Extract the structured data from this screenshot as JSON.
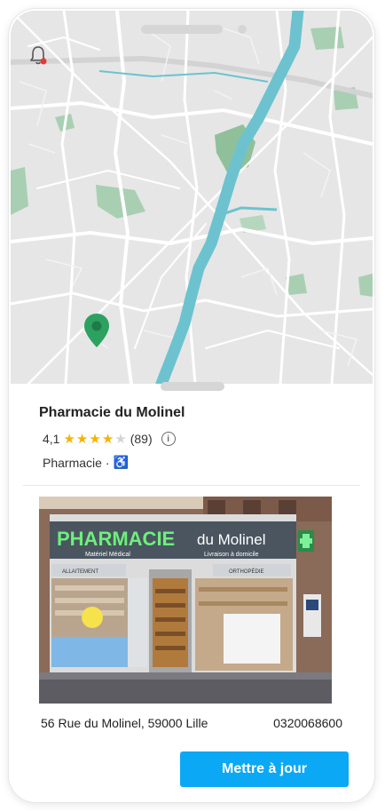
{
  "map": {
    "notification_icon": "bell-icon",
    "marker_icon": "location-pin-icon",
    "colors": {
      "background": "#e6e6e6",
      "road": "#ffffff",
      "river": "#6cc3cf",
      "park": "#8fc09a",
      "marker": "#2da160"
    }
  },
  "place": {
    "name": "Pharmacie du Molinel",
    "rating": "4,1",
    "stars": 4.1,
    "reviews": "(89)",
    "category": "Pharmacie",
    "category_separator": "·",
    "accessibility_icon": "wheelchair-icon",
    "info_icon": "info-icon"
  },
  "photo": {
    "sign_main": "PHARMACIE",
    "sign_secondary": "du Molinel",
    "sub_left": "Matériel Médical",
    "sub_right": "Livraison à domicile",
    "panel_left": "ALLAITEMENT",
    "panel_right": "ORTHOPÉDIE"
  },
  "details": {
    "address": "56 Rue du Molinel, 59000 Lille",
    "phone": "0320068600"
  },
  "actions": {
    "update_label": "Mettre à jour",
    "accent": "#0ba8f5"
  }
}
